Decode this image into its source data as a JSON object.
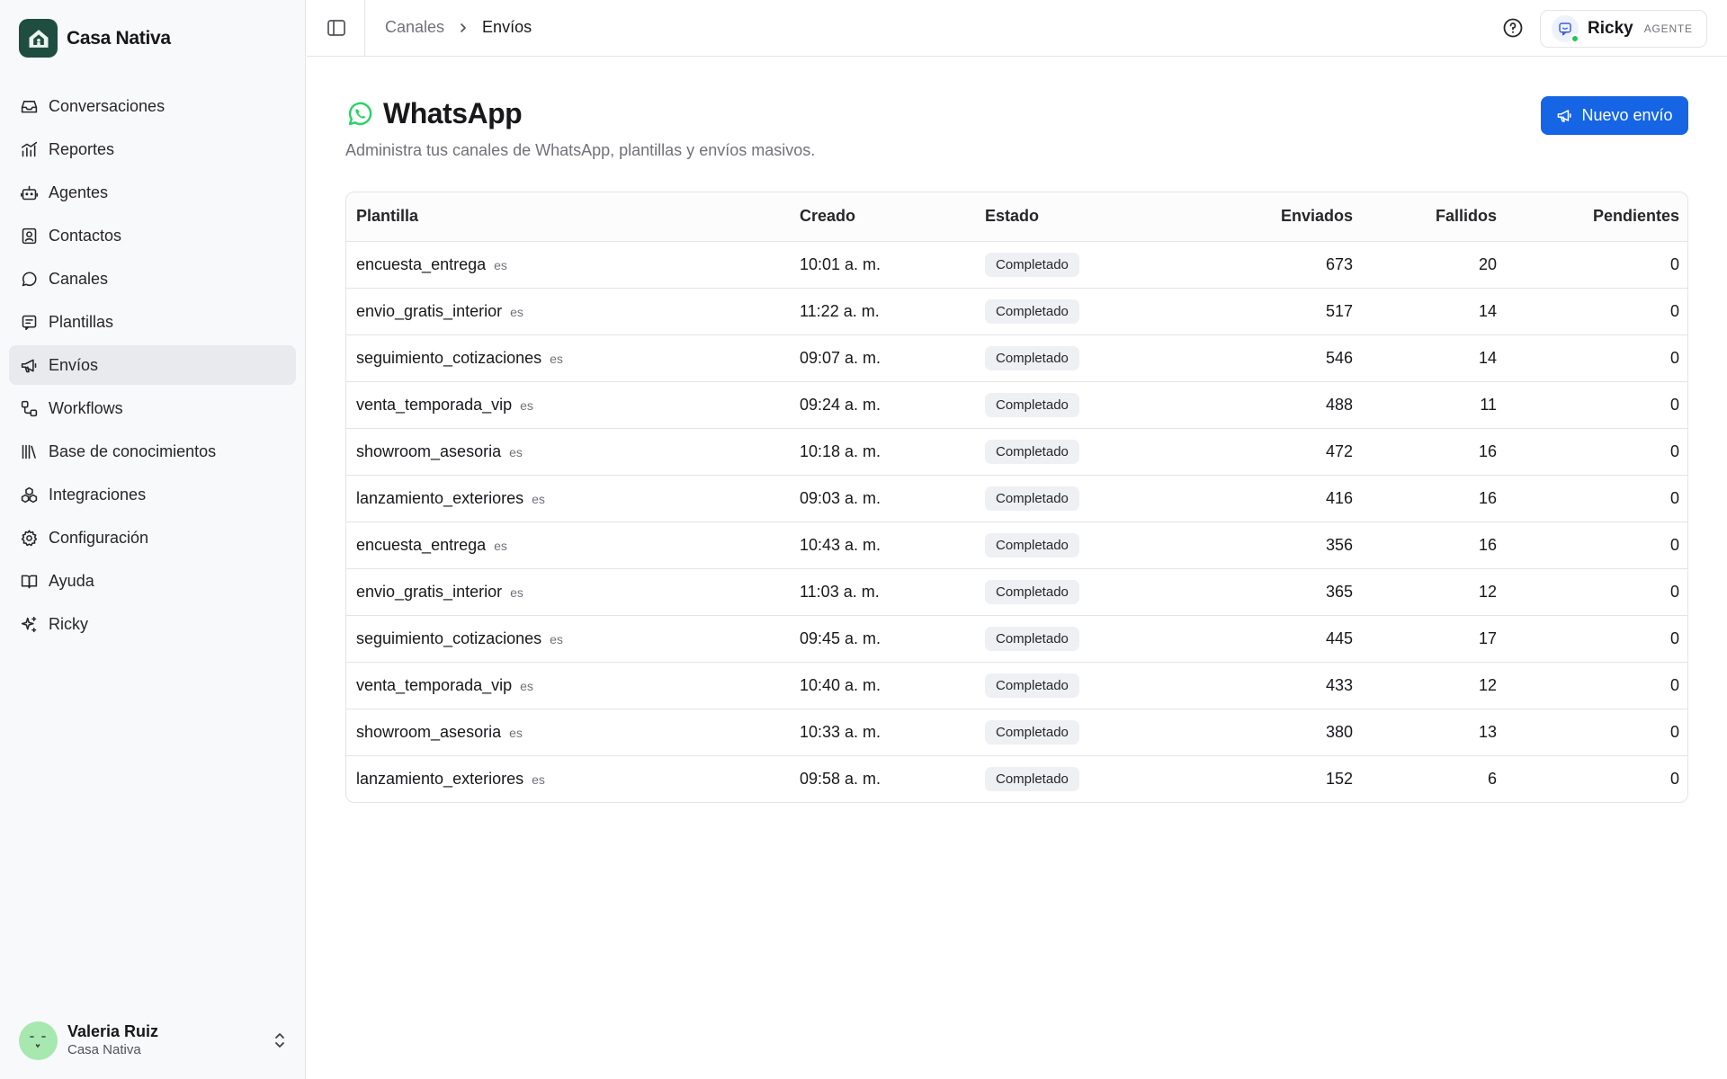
{
  "brand": {
    "name": "Casa Nativa"
  },
  "sidebar": {
    "items": [
      {
        "label": "Conversaciones",
        "icon": "inbox-icon"
      },
      {
        "label": "Reportes",
        "icon": "chart-icon"
      },
      {
        "label": "Agentes",
        "icon": "bot-icon"
      },
      {
        "label": "Contactos",
        "icon": "contact-icon"
      },
      {
        "label": "Canales",
        "icon": "chat-bubble-icon"
      },
      {
        "label": "Plantillas",
        "icon": "template-icon"
      },
      {
        "label": "Envíos",
        "icon": "megaphone-icon",
        "active": true
      },
      {
        "label": "Workflows",
        "icon": "workflow-icon"
      },
      {
        "label": "Base de conocimientos",
        "icon": "library-icon"
      },
      {
        "label": "Integraciones",
        "icon": "integrations-icon"
      },
      {
        "label": "Configuración",
        "icon": "gear-icon"
      },
      {
        "label": "Ayuda",
        "icon": "book-icon"
      },
      {
        "label": "Ricky",
        "icon": "sparkles-icon"
      }
    ],
    "user": {
      "name": "Valeria Ruiz",
      "org": "Casa Nativa"
    }
  },
  "header": {
    "breadcrumb": {
      "parent": "Canales",
      "current": "Envíos"
    },
    "agent": {
      "name": "Ricky",
      "tag": "AGENTE",
      "status_color": "#22c55e"
    }
  },
  "main": {
    "title": "WhatsApp",
    "subtitle": "Administra tus canales de WhatsApp, plantillas y envíos masivos.",
    "new_button": "Nuevo envío",
    "accent_color": "#1565e5",
    "whatsapp_color": "#25d366",
    "table": {
      "columns": [
        "Plantilla",
        "Creado",
        "Estado",
        "Enviados",
        "Fallidos",
        "Pendientes"
      ],
      "rows": [
        {
          "template": "encuesta_entrega",
          "lang": "es",
          "created": "10:01 a. m.",
          "status": "Completado",
          "sent": "673",
          "failed": "20",
          "pending": "0"
        },
        {
          "template": "envio_gratis_interior",
          "lang": "es",
          "created": "11:22 a. m.",
          "status": "Completado",
          "sent": "517",
          "failed": "14",
          "pending": "0"
        },
        {
          "template": "seguimiento_cotizaciones",
          "lang": "es",
          "created": "09:07 a. m.",
          "status": "Completado",
          "sent": "546",
          "failed": "14",
          "pending": "0"
        },
        {
          "template": "venta_temporada_vip",
          "lang": "es",
          "created": "09:24 a. m.",
          "status": "Completado",
          "sent": "488",
          "failed": "11",
          "pending": "0"
        },
        {
          "template": "showroom_asesoria",
          "lang": "es",
          "created": "10:18 a. m.",
          "status": "Completado",
          "sent": "472",
          "failed": "16",
          "pending": "0"
        },
        {
          "template": "lanzamiento_exteriores",
          "lang": "es",
          "created": "09:03 a. m.",
          "status": "Completado",
          "sent": "416",
          "failed": "16",
          "pending": "0"
        },
        {
          "template": "encuesta_entrega",
          "lang": "es",
          "created": "10:43 a. m.",
          "status": "Completado",
          "sent": "356",
          "failed": "16",
          "pending": "0"
        },
        {
          "template": "envio_gratis_interior",
          "lang": "es",
          "created": "11:03 a. m.",
          "status": "Completado",
          "sent": "365",
          "failed": "12",
          "pending": "0"
        },
        {
          "template": "seguimiento_cotizaciones",
          "lang": "es",
          "created": "09:45 a. m.",
          "status": "Completado",
          "sent": "445",
          "failed": "17",
          "pending": "0"
        },
        {
          "template": "venta_temporada_vip",
          "lang": "es",
          "created": "10:40 a. m.",
          "status": "Completado",
          "sent": "433",
          "failed": "12",
          "pending": "0"
        },
        {
          "template": "showroom_asesoria",
          "lang": "es",
          "created": "10:33 a. m.",
          "status": "Completado",
          "sent": "380",
          "failed": "13",
          "pending": "0"
        },
        {
          "template": "lanzamiento_exteriores",
          "lang": "es",
          "created": "09:58 a. m.",
          "status": "Completado",
          "sent": "152",
          "failed": "6",
          "pending": "0"
        }
      ]
    }
  }
}
